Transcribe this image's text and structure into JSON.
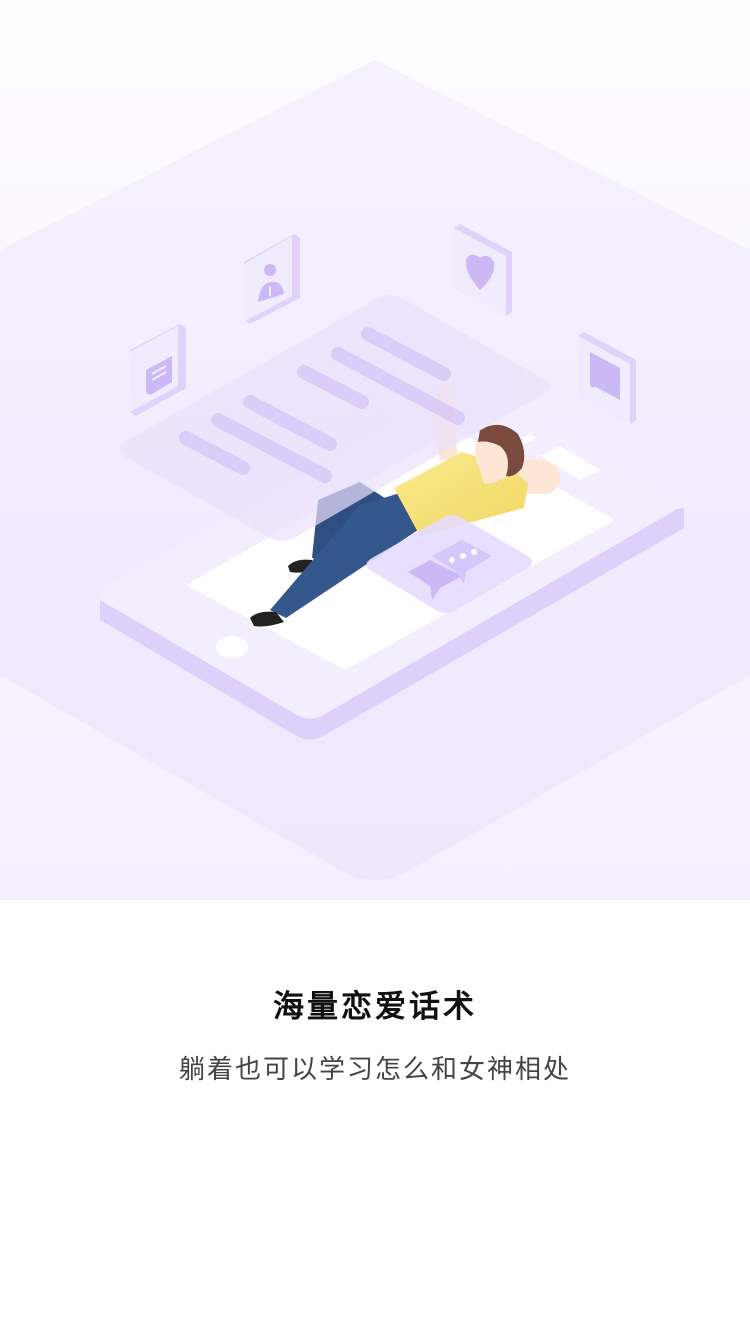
{
  "onboarding": {
    "title": "海量恋爱话术",
    "subtitle": "躺着也可以学习怎么和女神相处"
  },
  "illustration": {
    "icons": [
      "document-icon",
      "profile-icon",
      "heart-icon",
      "book-icon",
      "chat-bubble-icon"
    ],
    "colors": {
      "background_top": "#fcfbff",
      "floor": "#f1ebfd",
      "phone_body": "#f3eefe",
      "phone_edge": "#e0d2fb",
      "panel": "#ebe1fc",
      "line": "#d9c9f8",
      "shirt": "#f8e27a",
      "jeans": "#33578a",
      "skin": "#fde6d6",
      "hair": "#7b4a3f"
    }
  }
}
